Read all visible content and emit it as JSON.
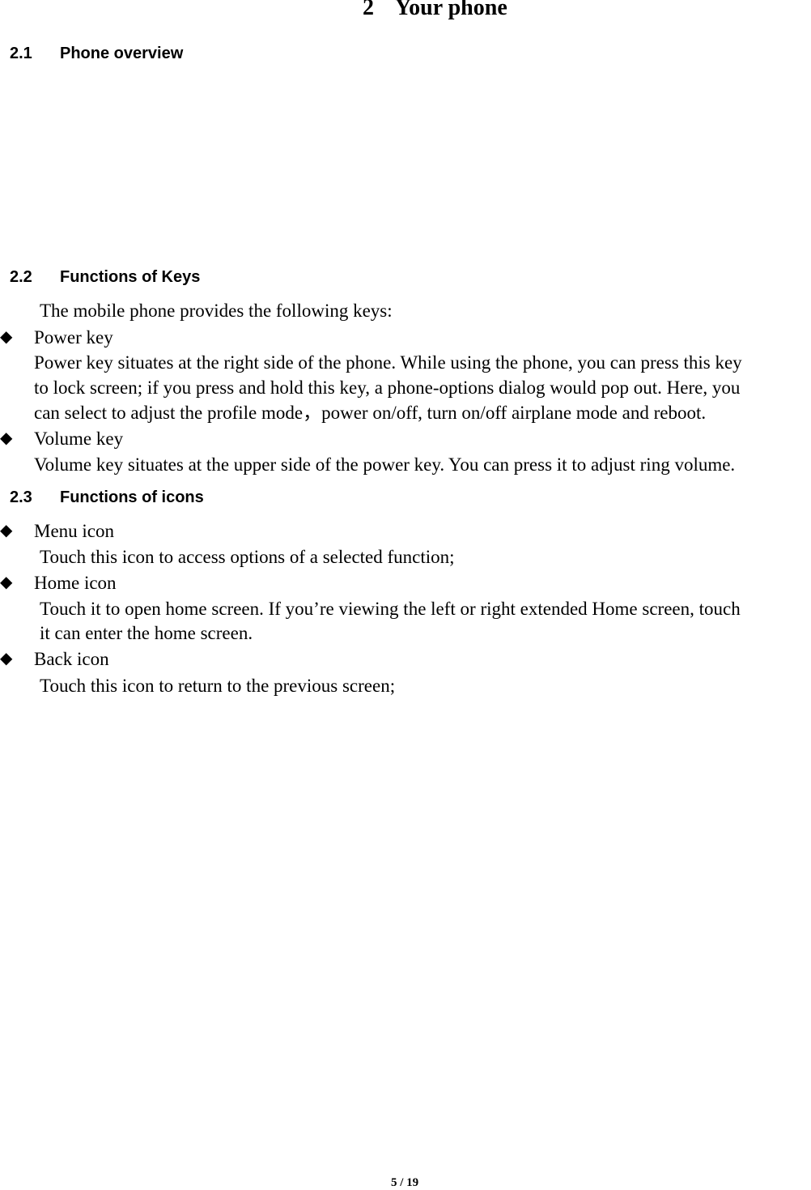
{
  "chapter": {
    "number": "2",
    "title": "Your phone"
  },
  "sections": [
    {
      "number": "2.1",
      "title": "Phone overview"
    },
    {
      "number": "2.2",
      "title": "Functions of Keys"
    },
    {
      "number": "2.3",
      "title": "Functions of icons"
    }
  ],
  "keys": {
    "intro": "The mobile phone provides the following keys:",
    "items": [
      {
        "label": "Power key",
        "lines": [
          "Power key situates at the right side of the phone. While using the phone, you can press this key",
          "to lock screen; if you press and hold this key, a phone-options dialog would pop out. Here, you",
          "can select to adjust the profile mode，power on/off, turn on/off airplane mode and reboot."
        ]
      },
      {
        "label": "Volume key",
        "lines": [
          "Volume key situates at the upper side of the power key. You can press it to adjust ring volume."
        ]
      }
    ]
  },
  "icons": {
    "items": [
      {
        "label": "Menu icon",
        "lines": [
          "Touch this icon to access options of a selected function;"
        ]
      },
      {
        "label": "Home icon",
        "lines": [
          "Touch it to open home screen. If you’re viewing the left or right extended Home screen, touch",
          "it can enter the home screen."
        ]
      },
      {
        "label": "Back icon",
        "lines": [
          "Touch this icon to return to the previous screen;"
        ]
      }
    ]
  },
  "bullet_glyph": "◆",
  "footer": {
    "page": "5 / 19"
  }
}
